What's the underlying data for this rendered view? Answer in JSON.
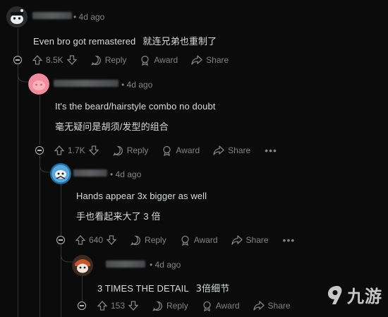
{
  "comments": [
    {
      "time": "4d ago",
      "text_en": "Even bro got remastered",
      "text_cn": "就连兄弟也重制了",
      "score": "8.5K",
      "reply_label": "Reply",
      "award_label": "Award",
      "share_label": "Share"
    },
    {
      "time": "4d ago",
      "text_en": "It's the beard/hairstyle combo no doubt",
      "text_cn": "毫无疑问是胡须/发型的组合",
      "score": "1.7K",
      "reply_label": "Reply",
      "award_label": "Award",
      "share_label": "Share"
    },
    {
      "time": "4d ago",
      "text_en": "Hands appear 3x bigger as well",
      "text_cn": "手也看起来大了 3 倍",
      "score": "640",
      "reply_label": "Reply",
      "award_label": "Award",
      "share_label": "Share"
    },
    {
      "time": "4d ago",
      "text_en": "3 TIMES THE DETAIL",
      "text_cn": "3倍细节",
      "score": "153",
      "reply_label": "Reply",
      "award_label": "Award",
      "share_label": "Share"
    }
  ],
  "meta_separator": "•",
  "more_label": "•••",
  "watermark": {
    "text": "九游",
    "icon": "jiuyou-logo-icon"
  },
  "colors": {
    "background": "#0b0b0b",
    "text": "#d7dadc",
    "muted": "#818384",
    "thread_line": "#343536"
  }
}
